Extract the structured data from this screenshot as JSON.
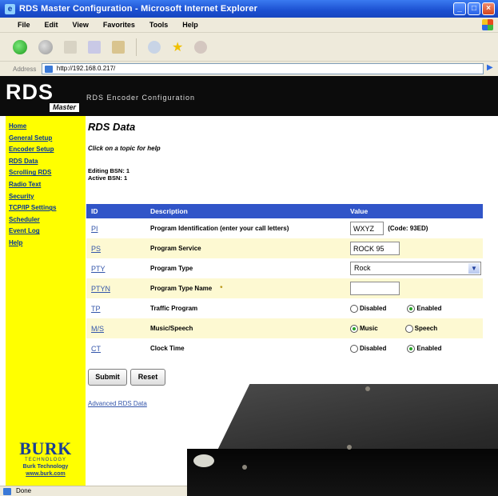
{
  "window": {
    "title": "RDS Master Configuration - Microsoft Internet Explorer",
    "buttons": [
      "_",
      "□",
      "×"
    ]
  },
  "menu": [
    "File",
    "Edit",
    "View",
    "Favorites",
    "Tools",
    "Help"
  ],
  "address": {
    "label": "Address",
    "url": "http://192.168.0.217/"
  },
  "banner": {
    "logo_main": "RDS",
    "logo_sub": "Master",
    "subtitle": "RDS Encoder Configuration"
  },
  "nav": [
    "Home",
    "General Setup",
    "Encoder Setup",
    "RDS Data",
    "Scrolling RDS",
    "Radio Text",
    "Security",
    "TCP/IP Settings",
    "Scheduler",
    "Event Log",
    "Help"
  ],
  "brand": {
    "name": "BURK",
    "tagline": "TECHNOLOGY",
    "company": "Burk Technology",
    "url": "www.burk.com"
  },
  "page": {
    "title": "RDS Data",
    "hint": "Click on a topic for help",
    "editing_bsn": "Editing BSN: 1",
    "active_bsn": "Active BSN: 1"
  },
  "table": {
    "headers": {
      "id": "ID",
      "description": "Description",
      "value": "Value"
    },
    "rows": {
      "pi": {
        "id": "PI",
        "desc": "Program Identification (enter your call letters)",
        "value": "WXYZ",
        "code": "(Code: 93ED)"
      },
      "ps": {
        "id": "PS",
        "desc": "Program Service",
        "value": "ROCK 95"
      },
      "pty": {
        "id": "PTY",
        "desc": "Program Type",
        "value": "Rock"
      },
      "ptyn": {
        "id": "PTYN",
        "desc": "Program Type Name",
        "value": ""
      },
      "tp": {
        "id": "TP",
        "desc": "Traffic Program",
        "opt1": "Disabled",
        "opt2": "Enabled",
        "selected": "Enabled"
      },
      "ms": {
        "id": "M/S",
        "desc": "Music/Speech",
        "opt1": "Music",
        "opt2": "Speech",
        "selected": "Music"
      },
      "ct": {
        "id": "CT",
        "desc": "Clock Time",
        "opt1": "Disabled",
        "opt2": "Enabled",
        "selected": "Enabled"
      }
    }
  },
  "actions": {
    "submit": "Submit",
    "reset": "Reset",
    "advanced": "Advanced RDS Data"
  },
  "status": {
    "text": "Done"
  },
  "colors": {
    "sidebar": "#ffff00",
    "table_header": "#3155c8",
    "alt_row": "#fdf9d2",
    "banner": "#0c0c0c",
    "link": "#003399"
  }
}
